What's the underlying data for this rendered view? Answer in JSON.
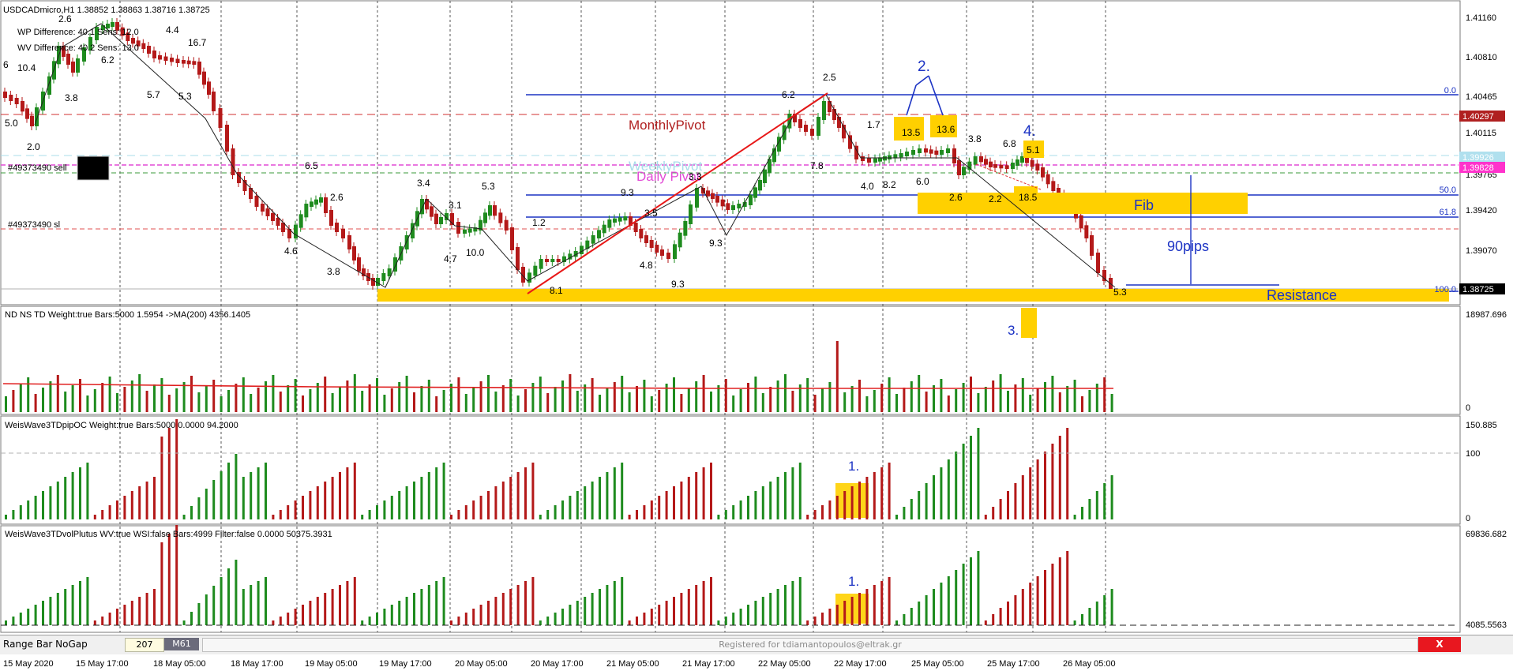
{
  "symbol_header": "USDCADmicro,H1  1.38852 1.38863 1.38716 1.38725",
  "panels": {
    "main": {
      "wp_label": "WP Difference: 40.1 Sens: 12.0",
      "wv_label": "WV Difference: 40.2 Sens: 13.0",
      "price_labels": [
        "1.41160",
        "1.40810",
        "1.40465",
        "1.40115",
        "1.39765",
        "1.39420",
        "1.39070"
      ],
      "highlight_prices": [
        {
          "text": "1.40297",
          "bg": "#b02020",
          "color": "#ffffff"
        },
        {
          "text": "1.39926",
          "bg": "#b0e0ee",
          "color": "#ffffff"
        },
        {
          "text": "1.39828",
          "bg": "#ff33cc",
          "color": "#ffffff"
        },
        {
          "text": "1.38725",
          "bg": "#000000",
          "color": "#ffffff"
        }
      ],
      "fib_levels": [
        "0.0",
        "50.0",
        "61.8",
        "100.0"
      ],
      "trade_labels": [
        "#49373490 sell",
        "#49373490 sl"
      ],
      "annotations": {
        "monthly_pivot": "MonthlyPivot",
        "weekly_pivot": "WeeklyPivot",
        "daily_pivot": "Daily Pivot",
        "fib": "Fib",
        "pips": "90pips",
        "resistance": "Resistance",
        "mark_2": "2.",
        "mark_3": "3.",
        "mark_4": "4."
      },
      "wave_numbers": [
        "2.6",
        "6",
        "10.4",
        "3.8",
        "6.2",
        "4.4",
        "16.7",
        "5.7",
        "5.3",
        "5.0",
        "2.0",
        "6.5",
        "2.6",
        "4.6",
        "3.8",
        "3.4",
        "3.1",
        "5.3",
        "4.7",
        "10.0",
        "1.2",
        "9.3",
        "3.5",
        "3.3",
        "4.8",
        "9.3",
        "9.3",
        "8.1",
        "6.2",
        "2.5",
        "1.7",
        "7.8",
        "4.0",
        "8.2",
        "6.0",
        "13.5",
        "13.6",
        "3.8",
        "2.6",
        "6.8",
        "5.1",
        "2.2",
        "18.5",
        "5.3"
      ]
    },
    "ndns": {
      "title": "ND NS TD Weight:true Bars:5000   1.5954  ->MA(200) 4356.1405",
      "scale_top": "18987.696",
      "scale_bottom": "0"
    },
    "wwpip": {
      "title": "WeisWave3TDpipOC Weight:true Bars:5000 0.0000 94.2000",
      "scale_top": "150.885",
      "scale_mid": "100",
      "scale_bottom": "0",
      "mark": "1."
    },
    "wwvol": {
      "title": "WeisWave3TDvolPlutus WV:true WSI:false Bars:4999 Filter:false 0.0000 50375.3931",
      "scale_top": "69836.682",
      "scale_bottom": "4085.5563",
      "mark": "1."
    }
  },
  "time_labels": [
    "15 May 2020",
    "15 May 17:00",
    "18 May 05:00",
    "18 May 17:00",
    "19 May 05:00",
    "19 May 17:00",
    "20 May 05:00",
    "20 May 17:00",
    "21 May 05:00",
    "21 May 17:00",
    "22 May 05:00",
    "22 May 17:00",
    "25 May 05:00",
    "25 May 17:00",
    "26 May 05:00"
  ],
  "toolbar": {
    "template": "Range Bar NoGap",
    "count": "207",
    "timeframe": "M61",
    "registration": "Registered for tdiamantopoulos@eltrak.gr",
    "close": "X"
  },
  "colors": {
    "bull": "#1e8b1e",
    "bear": "#b41919",
    "fib": "#1c33c4",
    "highlight": "#ffd000",
    "ma": "#e02020"
  }
}
